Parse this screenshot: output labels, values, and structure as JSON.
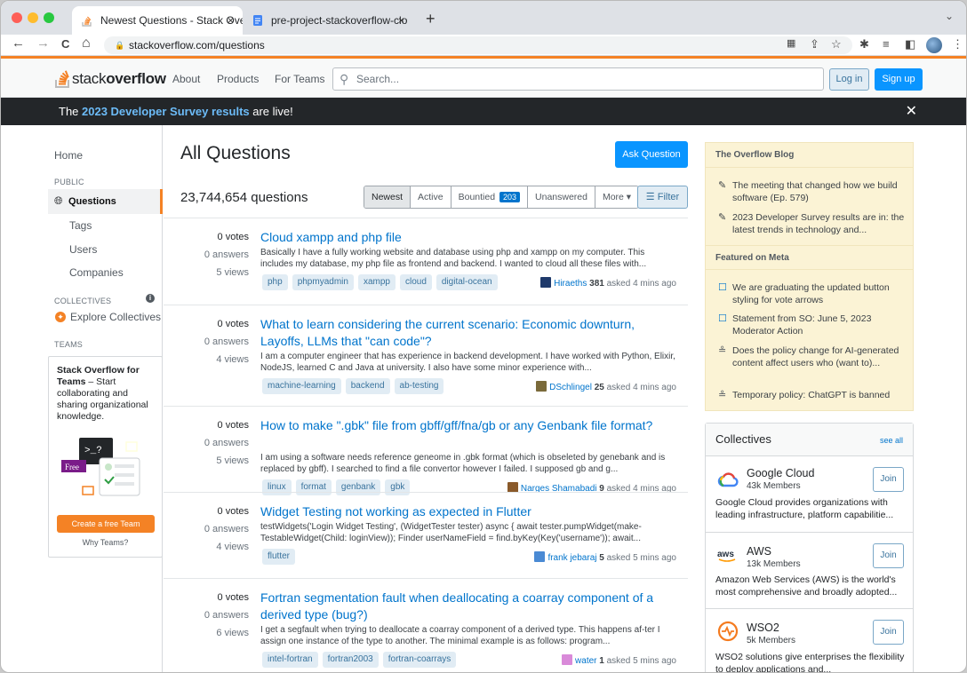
{
  "browser": {
    "tabs": [
      {
        "title": "Newest Questions - Stack Over",
        "close": "×"
      },
      {
        "title": "pre-project-stackoverflow-clo",
        "close": "×"
      }
    ],
    "new_tab": "+",
    "tab_menu": "⌄",
    "nav_back": "←",
    "nav_forward": "→",
    "nav_reload": "C",
    "nav_home": "⌂",
    "url": "stackoverflow.com/questions"
  },
  "topbar": {
    "logo_light": "stack",
    "logo_bold": "overflow",
    "links": [
      "About",
      "Products",
      "For Teams"
    ],
    "search_placeholder": "Search...",
    "login": "Log in",
    "signup": "Sign up"
  },
  "banner": {
    "pre": "The ",
    "link": "2023 Developer Survey results",
    "post": " are live!",
    "close": "✕"
  },
  "sidebar": {
    "home": "Home",
    "public": "PUBLIC",
    "questions": "Questions",
    "tags": "Tags",
    "users": "Users",
    "companies": "Companies",
    "collectives_head": "COLLECTIVES",
    "explore": "Explore Collectives",
    "teams_head": "TEAMS",
    "teams_title": "Stack Overflow for Teams",
    "teams_text": " – Start collaborating and sharing organizational knowledge.",
    "create_team": "Create a free Team",
    "why_teams": "Why Teams?",
    "free_label": "Free"
  },
  "main": {
    "title": "All Questions",
    "ask": "Ask Question",
    "count": "23,744,654 questions",
    "filters": [
      "Newest",
      "Active",
      "Bountied",
      "Unanswered",
      "More ▾"
    ],
    "bountied_count": "203",
    "filter_btn": "Filter"
  },
  "questions": [
    {
      "votes": "0 votes",
      "answers": "0 answers",
      "views": "5 views",
      "title": "Cloud xampp and php file",
      "excerpt": "Basically I have a fully working website and database using php and xampp on my computer. This includes my database, my php file as frontend and backend. I wanted to cloud all these files with...",
      "tags": [
        "php",
        "phpmyadmin",
        "xampp",
        "cloud",
        "digital-ocean"
      ],
      "user": "Hiraeths",
      "rep": "381",
      "time": "asked 4 mins ago",
      "avatar_color": "#1f3a6b"
    },
    {
      "votes": "0 votes",
      "answers": "0 answers",
      "views": "4 views",
      "title": "What to learn considering the current scenario: Economic downturn, Layoffs, LLMs that \"can code\"?",
      "excerpt": "I am a computer engineer that has experience in backend development. I have worked with Python, Elixir, NodeJS, learned C and Java at university. I also have some minor experience with...",
      "tags": [
        "machine-learning",
        "backend",
        "ab-testing"
      ],
      "user": "DSchlingel",
      "rep": "25",
      "time": "asked 4 mins ago",
      "avatar_color": "#7a6a3a"
    },
    {
      "votes": "0 votes",
      "answers": "0 answers",
      "views": "5 views",
      "title": "How to make \".gbk\" file from gbff/gff/fna/gb or any Genbank file format?",
      "excerpt": "I am using a software needs reference geneome in .gbk format (which is obseleted by genebank and is replaced by gbff). I searched to find a file convertor however I failed. I supposed gb and g...",
      "tags": [
        "linux",
        "format",
        "genbank",
        "gbk"
      ],
      "user": "Narges Shamabadi",
      "rep": "9",
      "time": "asked 4 mins ago",
      "avatar_color": "#8a5a2a"
    },
    {
      "votes": "0 votes",
      "answers": "0 answers",
      "views": "4 views",
      "title": "Widget Testing not working as expected in Flutter",
      "excerpt": "testWidgets('Login Widget Testing', (WidgetTester tester) async { await tester.pumpWidget(make-TestableWidget(Child: loginView)); Finder userNameField = find.byKey(Key('username')); await...",
      "tags": [
        "flutter"
      ],
      "user": "frank jebaraj",
      "rep": "5",
      "time": "asked 5 mins ago",
      "avatar_color": "#4a8ad4"
    },
    {
      "votes": "0 votes",
      "answers": "0 answers",
      "views": "6 views",
      "title": "Fortran segmentation fault when deallocating a coarray component of a derived type (bug?)",
      "excerpt": "I get a segfault when trying to deallocate a coarray component of a derived type. This happens af-ter I assign one instance of the type to another. The minimal example is as follows: program...",
      "tags": [
        "intel-fortran",
        "fortran2003",
        "fortran-coarrays"
      ],
      "user": "water",
      "rep": "1",
      "time": "asked 5 mins ago",
      "avatar_color": "#d98ad9"
    }
  ],
  "blog": {
    "head1": "The Overflow Blog",
    "items1": [
      "The meeting that changed how we build software (Ep. 579)",
      "2023 Developer Survey results are in: the latest trends in technology and..."
    ],
    "head2": "Featured on Meta",
    "items2": [
      "We are graduating the updated button styling for vote arrows",
      "Statement from SO: June 5, 2023 Moderator Action",
      "Does the policy change for AI-generated content affect users who (want to)...",
      "Temporary policy: ChatGPT is banned"
    ]
  },
  "collectives": {
    "head": "Collectives",
    "see_all": "see all",
    "join": "Join",
    "items": [
      {
        "name": "Google Cloud",
        "members": "43k Members",
        "desc": "Google Cloud provides organizations with leading infrastructure, platform capabilitie..."
      },
      {
        "name": "AWS",
        "members": "13k Members",
        "desc": "Amazon Web Services (AWS) is the world's most comprehensive and broadly adopted..."
      },
      {
        "name": "WSO2",
        "members": "5k Members",
        "desc": "WSO2 solutions give enterprises the flexibility to deploy applications and..."
      }
    ]
  },
  "colors": {
    "accent": "#f48225",
    "link": "#0074cc",
    "primary": "#0a95ff"
  }
}
